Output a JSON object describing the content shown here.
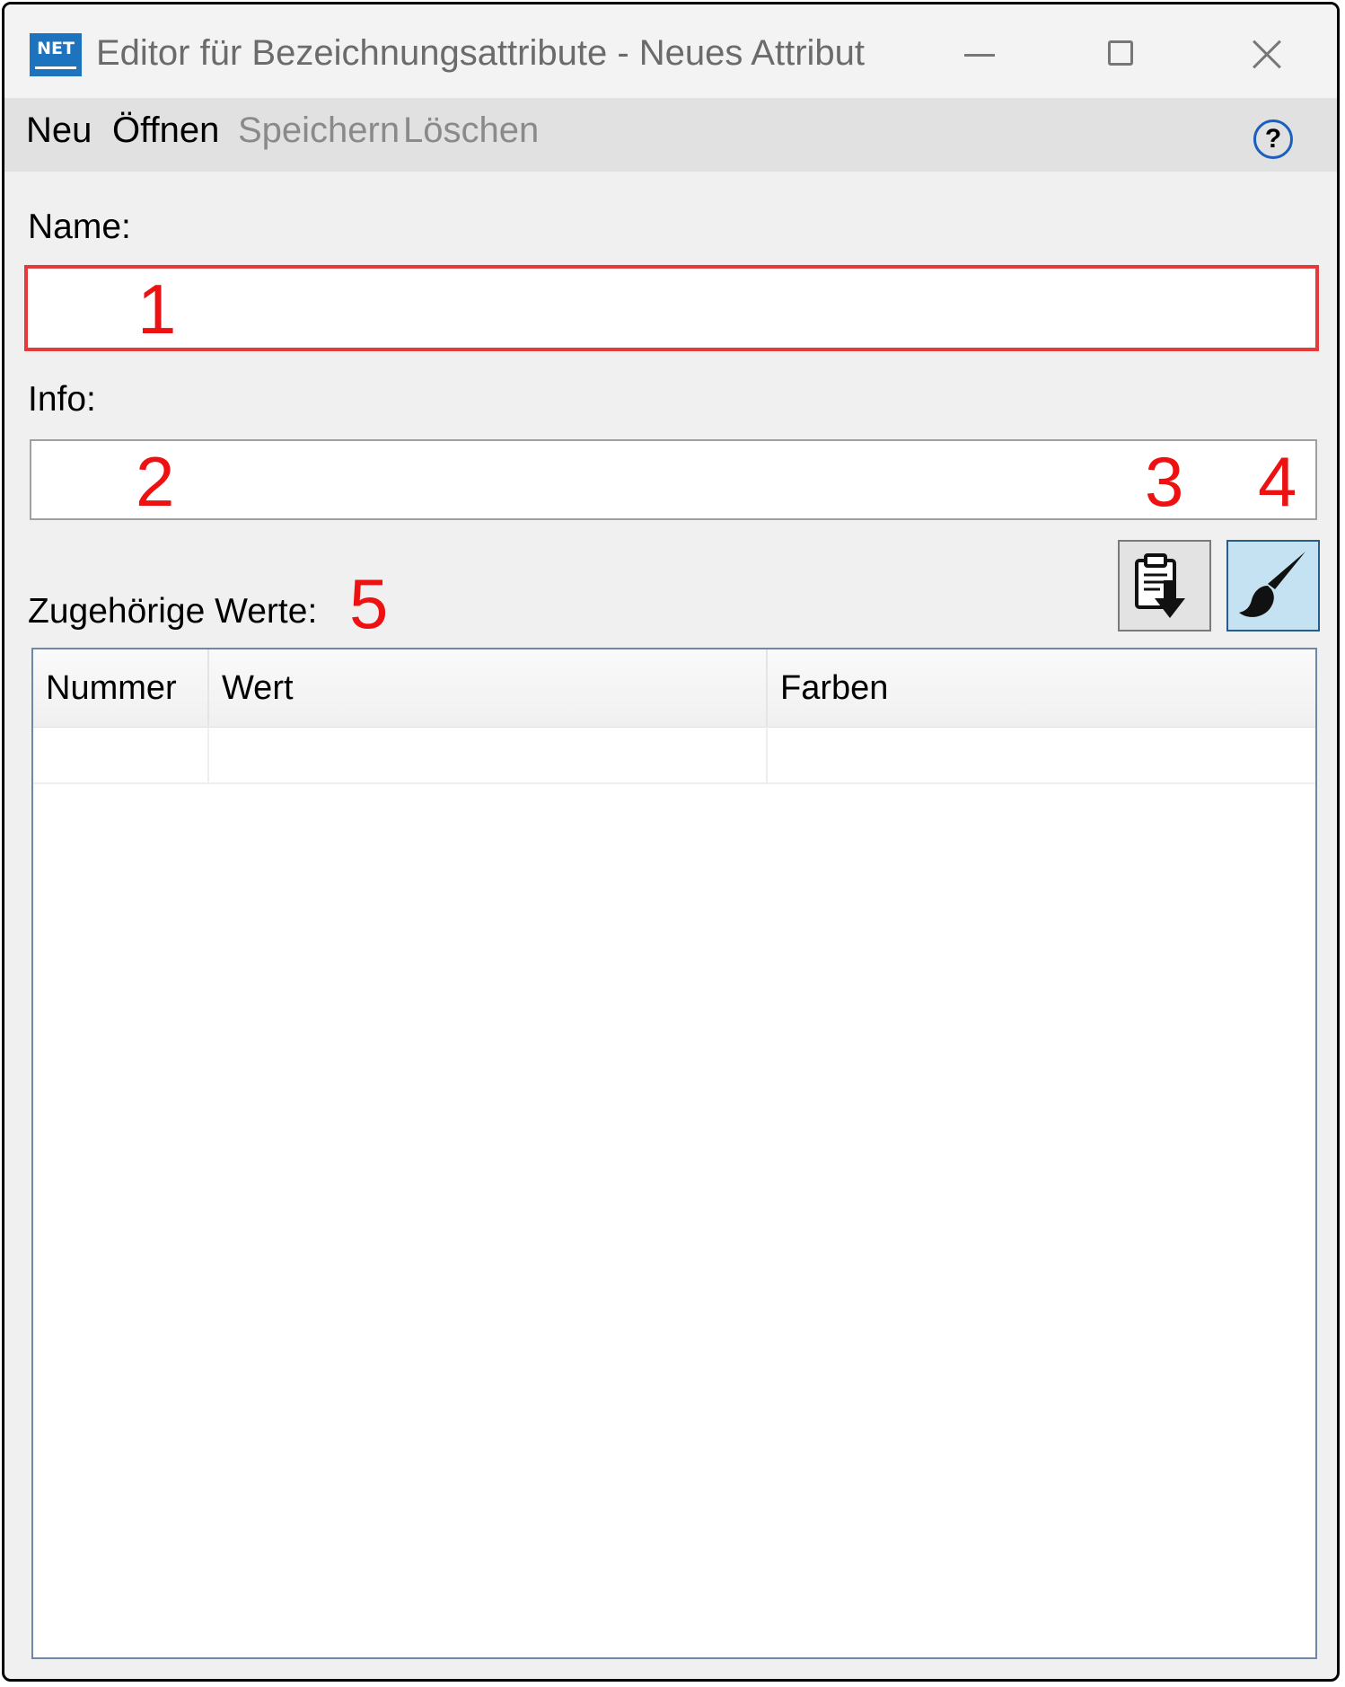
{
  "window": {
    "app_icon_text": "NET",
    "title": "Editor für Bezeichnungsattribute - Neues Attribut"
  },
  "menu": {
    "items": [
      {
        "label": "Neu",
        "enabled": true
      },
      {
        "label": "Öffnen",
        "enabled": true
      },
      {
        "label": "Speichern",
        "enabled": false
      },
      {
        "label": "Löschen",
        "enabled": false
      }
    ],
    "help_symbol": "?"
  },
  "form": {
    "name_label": "Name:",
    "name_value": "",
    "info_label": "Info:",
    "info_value": "",
    "values_label": "Zugehörige Werte:"
  },
  "toolbar": {
    "paste_icon": "clipboard-paste-icon",
    "color_icon": "paintbrush-icon",
    "color_active": true
  },
  "table": {
    "columns": [
      "Nummer",
      "Wert",
      "Farben"
    ],
    "rows": [
      [
        "",
        "",
        ""
      ]
    ]
  },
  "annotations": [
    "1",
    "2",
    "3",
    "4",
    "5"
  ],
  "colors": {
    "error_border": "#e5393a",
    "marker": "#ee1111",
    "active_button": "#c5e2f3",
    "help_accent": "#1b5fbf",
    "app_icon": "#1e73be"
  }
}
